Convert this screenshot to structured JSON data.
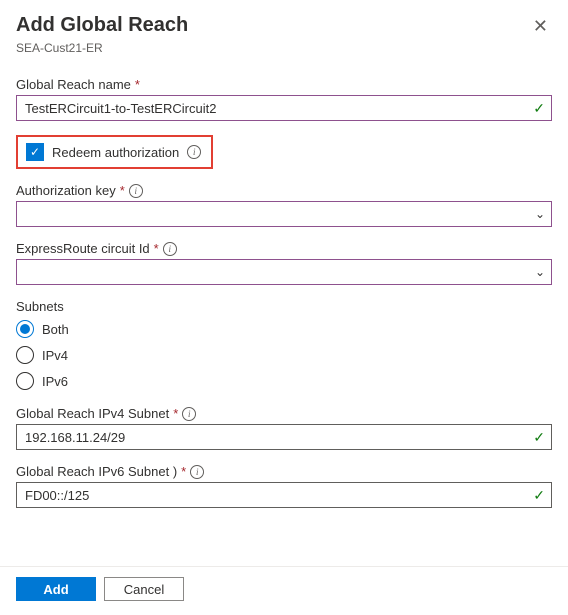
{
  "header": {
    "title": "Add Global Reach",
    "subtitle": "SEA-Cust21-ER",
    "close_label": "✕"
  },
  "fields": {
    "name": {
      "label": "Global Reach name",
      "value": "TestERCircuit1-to-TestERCircuit2",
      "required": true
    },
    "redeem": {
      "label": "Redeem authorization",
      "checked": true
    },
    "auth_key": {
      "label": "Authorization key",
      "value": "",
      "required": true
    },
    "circuit_id": {
      "label": "ExpressRoute circuit Id",
      "value": "",
      "required": true
    },
    "subnets": {
      "label": "Subnets",
      "options": [
        "Both",
        "IPv4",
        "IPv6"
      ],
      "selected": "Both"
    },
    "ipv4_subnet": {
      "label": "Global Reach IPv4 Subnet",
      "value": "192.168.11.24/29",
      "required": true
    },
    "ipv6_subnet": {
      "label": "Global Reach IPv6 Subnet )",
      "value": "FD00::/125",
      "required": true
    }
  },
  "footer": {
    "add_label": "Add",
    "cancel_label": "Cancel"
  },
  "icons": {
    "info": "i",
    "check": "✓",
    "chevron": "⌄"
  }
}
